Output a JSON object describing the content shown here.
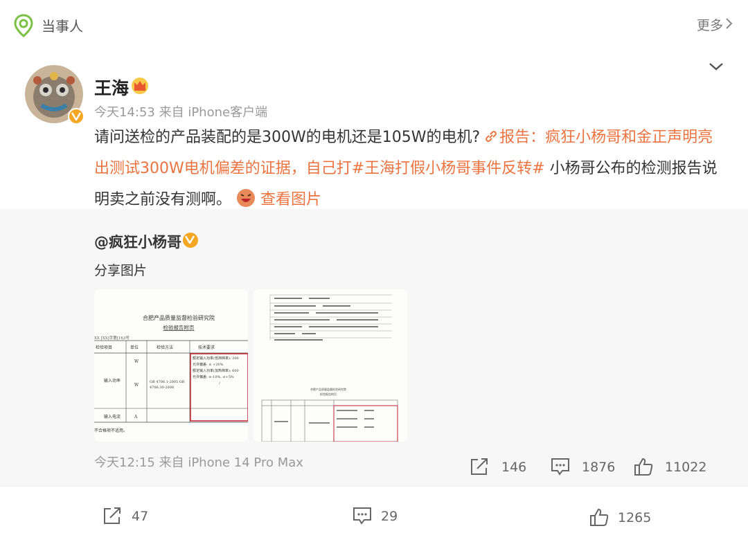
{
  "topic": {
    "label": "当事人",
    "more": "更多",
    "icon": "topic-pin-icon"
  },
  "post": {
    "author": "王海",
    "meta": "今天14:53  来自 iPhone客户端",
    "text_prefix": "请问送检的产品装配的是300W的电机还是105W的电机?",
    "link_text": "报告：疯狂小杨哥和金正声明亮出测试300W电机偏差的证据，自己打",
    "hashtag": "#王海打假小杨哥事件反转#",
    "text_suffix": " 小杨哥公布的检测报告说明卖之前没有测啊。",
    "view_images": "查看图片"
  },
  "repost": {
    "author": "@疯狂小杨哥",
    "text": "分享图片",
    "meta": "今天12:15 来自 iPhone 14 Pro Max",
    "shares": "146",
    "comments": "1876",
    "likes": "11022",
    "images": [
      {
        "org": "合肥产品质量监督检验研究院",
        "title": "检验报告附页",
        "no": "XX [XX]字第[163号",
        "headers": [
          "检验项目",
          "单位",
          "检验方法",
          "技术要求"
        ],
        "rows": [
          "输入功率",
          "输入电流"
        ],
        "units": [
          "W",
          "W",
          "A"
        ],
        "method": "GB 4706.1-2005 GB 4706.30-2008",
        "req": [
          "额定输入功率(低挡档率): 300",
          "允许偏差: ≤ +20%",
          "额定输入功率(加热档率): 600",
          "允许偏差: ≥-10%, ≤+5%",
          "/"
        ],
        "note": "不合格项不适用。"
      },
      {
        "org": "合肥产品质量监督检验研究院",
        "title": "检验报告附页"
      }
    ]
  },
  "footer": {
    "shares": "47",
    "comments": "29",
    "likes": "1265"
  },
  "colors": {
    "link": "#eb7340",
    "badge": "#f5a623",
    "repost_bg": "#f7f7f7"
  }
}
